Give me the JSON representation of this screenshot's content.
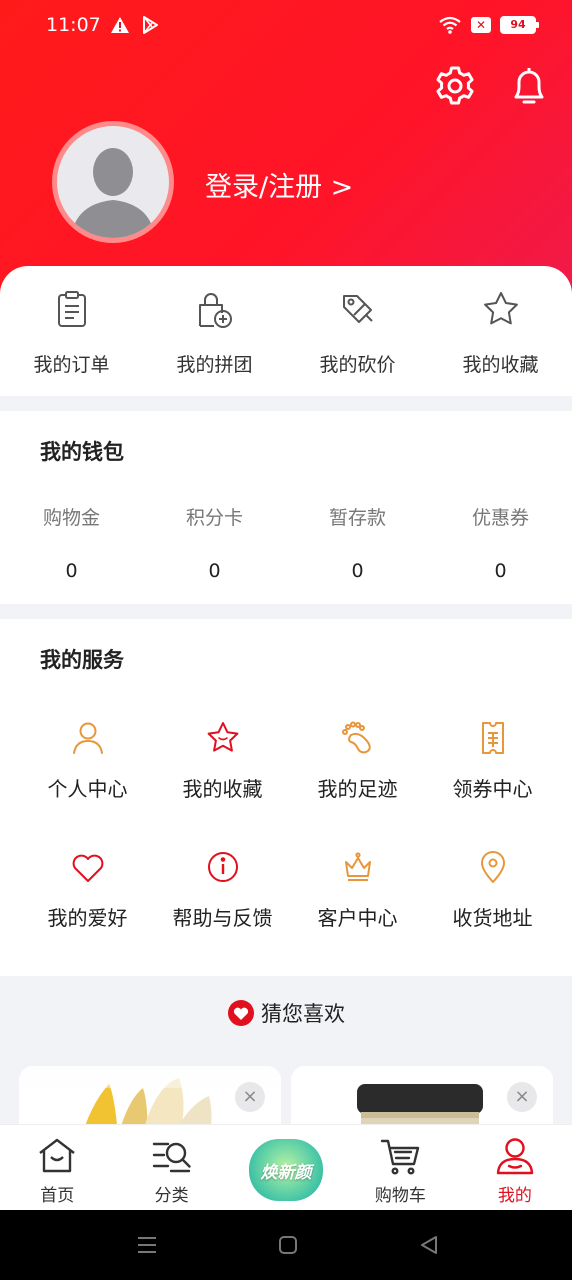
{
  "status_bar": {
    "time": "11:07",
    "battery": "94"
  },
  "header": {
    "login_text": "登录/注册 >"
  },
  "quick_actions": [
    {
      "label": "我的订单",
      "icon": "order-icon"
    },
    {
      "label": "我的拼团",
      "icon": "group-buy-icon"
    },
    {
      "label": "我的砍价",
      "icon": "bargain-tag-icon"
    },
    {
      "label": "我的收藏",
      "icon": "star-icon"
    }
  ],
  "wallet": {
    "title": "我的钱包",
    "items": [
      {
        "label": "购物金",
        "value": "0"
      },
      {
        "label": "积分卡",
        "value": "0"
      },
      {
        "label": "暂存款",
        "value": "0"
      },
      {
        "label": "优惠券",
        "value": "0"
      }
    ]
  },
  "services": {
    "title": "我的服务",
    "items": [
      {
        "label": "个人中心",
        "icon": "person-icon"
      },
      {
        "label": "我的收藏",
        "icon": "star-icon"
      },
      {
        "label": "我的足迹",
        "icon": "footprint-icon"
      },
      {
        "label": "领券中心",
        "icon": "coupon-icon"
      },
      {
        "label": "我的爱好",
        "icon": "heart-icon"
      },
      {
        "label": "帮助与反馈",
        "icon": "info-icon"
      },
      {
        "label": "客户中心",
        "icon": "crown-icon"
      },
      {
        "label": "收货地址",
        "icon": "location-icon"
      }
    ]
  },
  "guess": {
    "title": "猜您喜欢"
  },
  "tabbar": {
    "items": [
      {
        "label": "首页",
        "icon": "home-icon"
      },
      {
        "label": "分类",
        "icon": "category-search-icon"
      },
      {
        "label": "",
        "icon": "promo-badge",
        "badge_text": "焕新颜"
      },
      {
        "label": "购物车",
        "icon": "cart-icon"
      },
      {
        "label": "我的",
        "icon": "profile-icon",
        "active": true
      }
    ]
  },
  "colors": {
    "brand": "#e0101e",
    "service_orange": "#e8963c",
    "service_red": "#e0101e"
  }
}
